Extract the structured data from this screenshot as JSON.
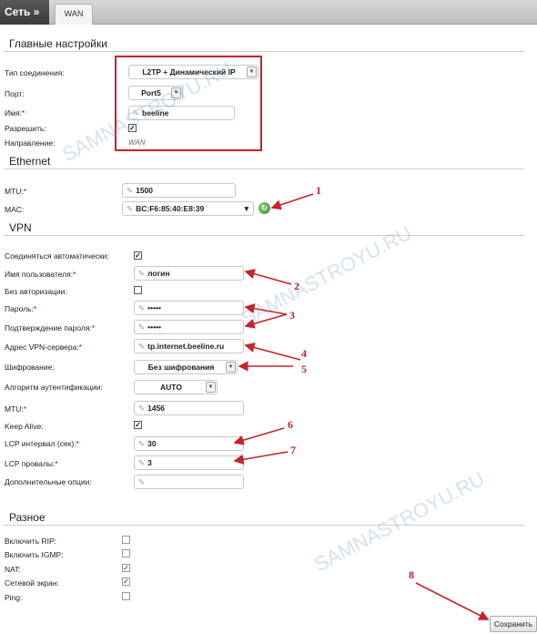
{
  "header": {
    "breadcrumb": "Сеть »",
    "tab": "WAN"
  },
  "sections": {
    "main": "Главные настройки",
    "ethernet": "Ethernet",
    "vpn": "VPN",
    "misc": "Разное"
  },
  "main": {
    "conn_type_label": "Тип соединения:",
    "conn_type_value": "L2TP + Динамический IP",
    "port_label": "Порт:",
    "port_value": "Port5",
    "name_label": "Имя:",
    "name_value": "beeline",
    "allow_label": "Разрешить:",
    "direction_label": "Направление:",
    "direction_value": "WAN"
  },
  "ethernet": {
    "mtu_label": "MTU:",
    "mtu_value": "1500",
    "mac_label": "MAC:",
    "mac_value": "BC:F6:85:40:E8:39"
  },
  "vpn": {
    "auto_label": "Соединяться автоматически:",
    "user_label": "Имя пользователя:",
    "user_value": "логин",
    "noauth_label": "Без авторизации:",
    "pass_label": "Пароль:",
    "pass_value": "•••••",
    "pass2_label": "Подтверждение пароля:",
    "pass2_value": "•••••",
    "server_label": "Адрес VPN-сервера:",
    "server_value": "tp.internet.beeline.ru",
    "enc_label": "Шифрование:",
    "enc_value": "Без шифрования",
    "auth_label": "Алгоритм аутентификации:",
    "auth_value": "AUTO",
    "mtu_label": "MTU:",
    "mtu_value": "1456",
    "keepalive_label": "Keep Alive:",
    "lcp_int_label": "LCP интервал (сек):",
    "lcp_int_value": "30",
    "lcp_fail_label": "LCP провалы:",
    "lcp_fail_value": "3",
    "extra_label": "Дополнительные опции:",
    "extra_value": ""
  },
  "misc": {
    "rip_label": "Включить RIP:",
    "igmp_label": "Включить IGMP:",
    "nat_label": "NAT:",
    "firewall_label": "Сетевой экран:",
    "ping_label": "Ping:"
  },
  "checks": {
    "allow": true,
    "auto": true,
    "noauth": false,
    "keepalive": true,
    "rip": false,
    "igmp": false,
    "nat": true,
    "firewall": true,
    "ping": false
  },
  "annotations": [
    "1",
    "2",
    "3",
    "4",
    "5",
    "6",
    "7",
    "8"
  ],
  "watermark": "SAMNASTROYU.RU",
  "save_label": "Сохранить",
  "colors": {
    "annotation": "#c8222a",
    "watermark": "#6496d2"
  }
}
